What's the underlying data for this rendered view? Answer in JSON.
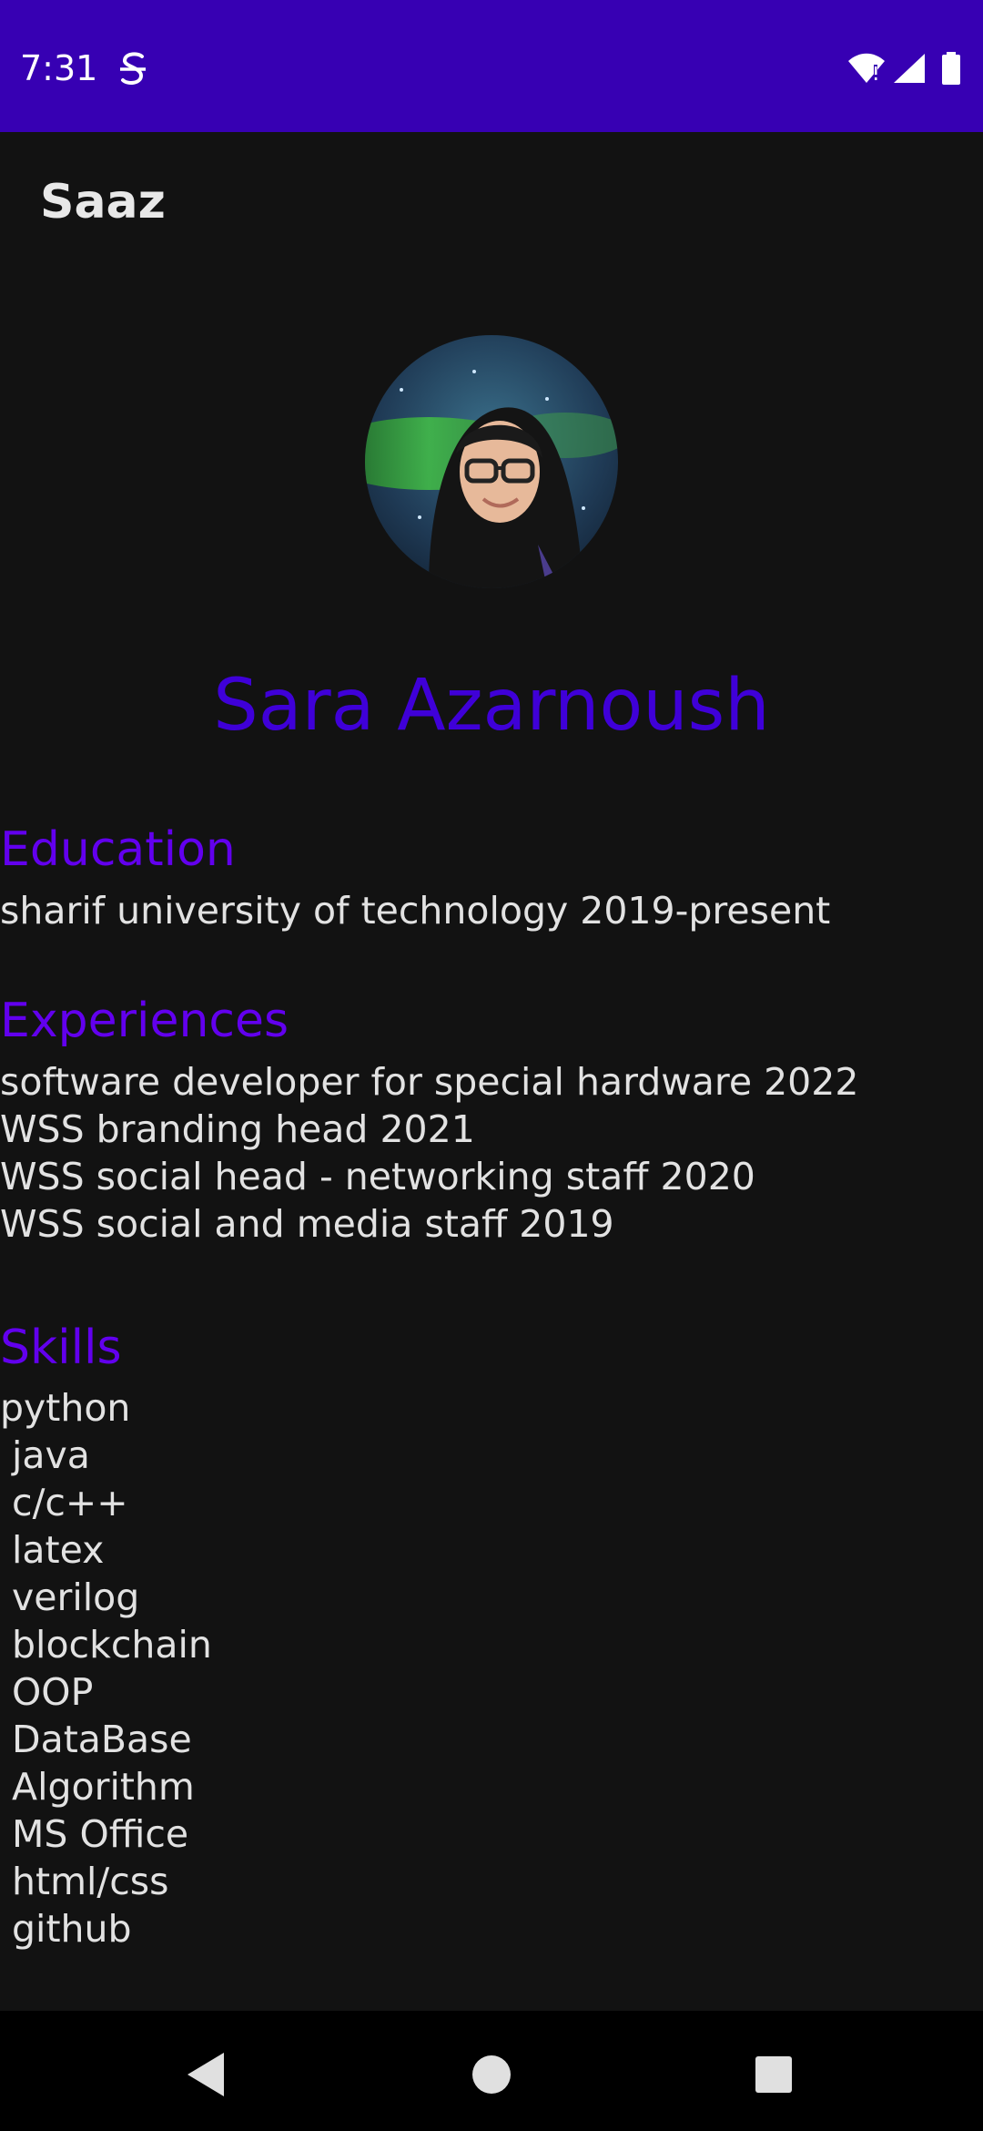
{
  "status_bar": {
    "time": "7:31",
    "icons": [
      "s-notification-icon",
      "wifi-icon",
      "signal-icon",
      "battery-icon"
    ],
    "background": "#3700b3"
  },
  "app_bar": {
    "title": "Saaz"
  },
  "profile": {
    "name": "Sara Azarnoush",
    "avatar_icon": "profile-photo"
  },
  "education": {
    "title": "Education",
    "items": [
      "sharif university of technology 2019-present"
    ]
  },
  "experiences": {
    "title": "Experiences",
    "items": [
      "software developer for special hardware 2022",
      "WSS branding head 2021",
      "WSS social head - networking staff 2020",
      "WSS social and media staff 2019"
    ]
  },
  "skills": {
    "title": "Skills",
    "items": [
      "python",
      " java",
      " c/c++",
      " latex",
      " verilog",
      " blockchain",
      " OOP",
      " DataBase",
      " Algorithm",
      " MS Office",
      " html/css",
      " github"
    ]
  },
  "nav_bar": {
    "icons": [
      "back-icon",
      "home-icon",
      "recents-icon"
    ]
  },
  "colors": {
    "accent": "#6200ee",
    "name": "#3f00d8",
    "background": "#121212"
  }
}
